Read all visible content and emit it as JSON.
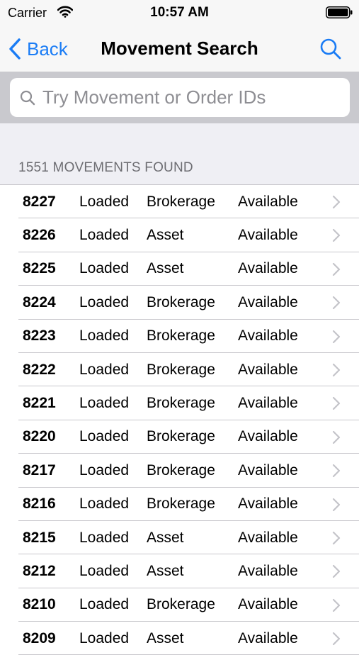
{
  "status_bar": {
    "carrier": "Carrier",
    "time": "10:57 AM"
  },
  "nav": {
    "back_label": "Back",
    "title": "Movement Search"
  },
  "search": {
    "placeholder": "Try Movement or Order IDs"
  },
  "results": {
    "header": "1551 MOVEMENTS FOUND",
    "rows": [
      {
        "id": "8227",
        "status": "Loaded",
        "type": "Brokerage",
        "availability": "Available"
      },
      {
        "id": "8226",
        "status": "Loaded",
        "type": "Asset",
        "availability": "Available"
      },
      {
        "id": "8225",
        "status": "Loaded",
        "type": "Asset",
        "availability": "Available"
      },
      {
        "id": "8224",
        "status": "Loaded",
        "type": "Brokerage",
        "availability": "Available"
      },
      {
        "id": "8223",
        "status": "Loaded",
        "type": "Brokerage",
        "availability": "Available"
      },
      {
        "id": "8222",
        "status": "Loaded",
        "type": "Brokerage",
        "availability": "Available"
      },
      {
        "id": "8221",
        "status": "Loaded",
        "type": "Brokerage",
        "availability": "Available"
      },
      {
        "id": "8220",
        "status": "Loaded",
        "type": "Brokerage",
        "availability": "Available"
      },
      {
        "id": "8217",
        "status": "Loaded",
        "type": "Brokerage",
        "availability": "Available"
      },
      {
        "id": "8216",
        "status": "Loaded",
        "type": "Brokerage",
        "availability": "Available"
      },
      {
        "id": "8215",
        "status": "Loaded",
        "type": "Asset",
        "availability": "Available"
      },
      {
        "id": "8212",
        "status": "Loaded",
        "type": "Asset",
        "availability": "Available"
      },
      {
        "id": "8210",
        "status": "Loaded",
        "type": "Brokerage",
        "availability": "Available"
      },
      {
        "id": "8209",
        "status": "Loaded",
        "type": "Asset",
        "availability": "Available"
      }
    ]
  },
  "colors": {
    "accent": "#1a7cf5",
    "secondary_text": "#6d6d72",
    "separator": "#c8c7cc"
  },
  "icons": {
    "back": "chevron-left-icon",
    "search": "magnifier-icon",
    "row": "chevron-right-icon"
  }
}
